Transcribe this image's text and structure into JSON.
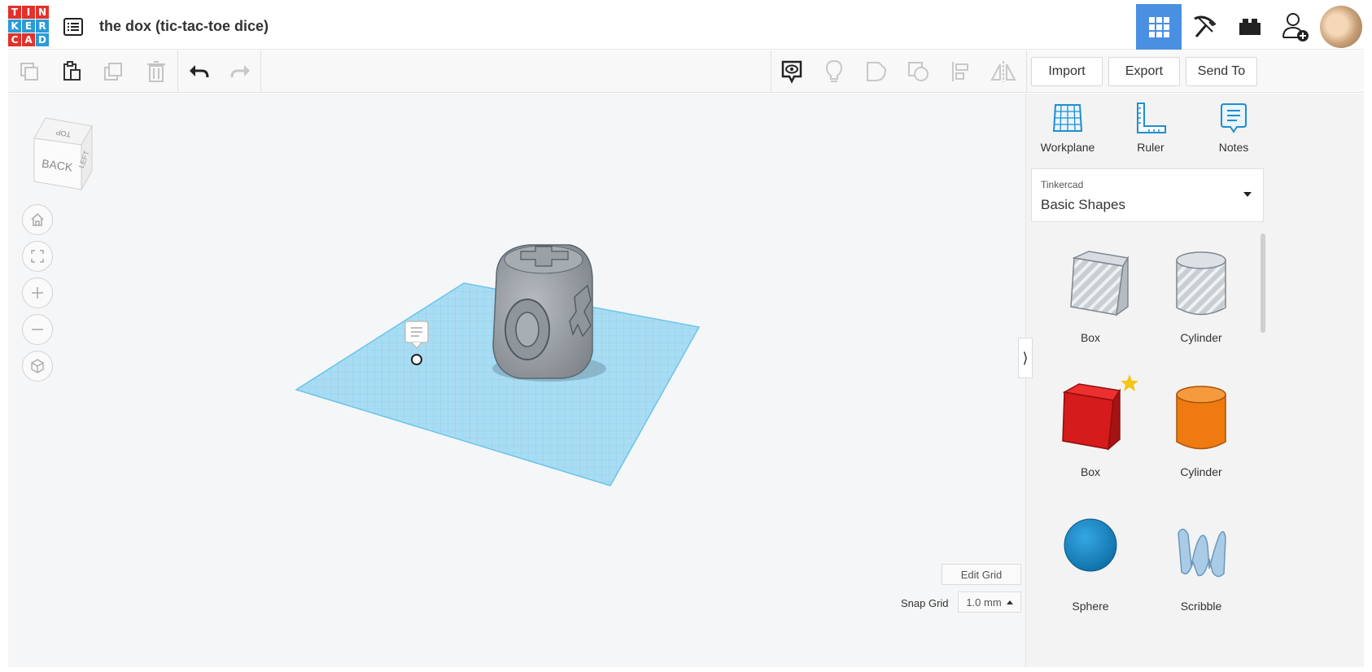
{
  "header": {
    "logo_letters": [
      "T",
      "I",
      "N",
      "K",
      "E",
      "R",
      "C",
      "A",
      "D"
    ],
    "logo_colors": [
      "#e2312b",
      "#e2312b",
      "#e2312b",
      "#2a9bd7",
      "#2a9bd7",
      "#2a9bd7",
      "#e2312b",
      "#e2312b",
      "#2a9bd7"
    ],
    "title": "the dox (tic-tac-toe dice)",
    "right_buttons": [
      "3d-design-grid-icon",
      "pickaxe-icon",
      "bricks-icon",
      "add-user-icon",
      "avatar"
    ]
  },
  "toolbar": {
    "edit_icons": [
      "copy-icon",
      "paste-icon",
      "duplicate-icon",
      "delete-icon",
      "undo-icon",
      "redo-icon"
    ],
    "view_icons": [
      "notes-visibility-icon",
      "lightbulb-icon",
      "group-icon",
      "ungroup-icon",
      "align-icon",
      "mirror-icon"
    ],
    "import_label": "Import",
    "export_label": "Export",
    "send_label": "Send To"
  },
  "canvas": {
    "viewcube_front": "BACK",
    "viewcube_top": "TOP",
    "viewcube_side": "LEFT",
    "nav_icons": [
      "home-icon",
      "fit-icon",
      "zoom-in-icon",
      "zoom-out-icon",
      "perspective-icon"
    ],
    "edit_grid_label": "Edit Grid",
    "snap_grid_label": "Snap Grid",
    "snap_grid_value": "1.0 mm"
  },
  "panel": {
    "tools": [
      {
        "label": "Workplane",
        "icon": "workplane-icon"
      },
      {
        "label": "Ruler",
        "icon": "ruler-icon"
      },
      {
        "label": "Notes",
        "icon": "notes-icon"
      }
    ],
    "library_source": "Tinkercad",
    "library_name": "Basic Shapes",
    "shapes": [
      {
        "label": "Box",
        "kind": "hole-box"
      },
      {
        "label": "Cylinder",
        "kind": "hole-cylinder"
      },
      {
        "label": "Box",
        "kind": "solid-box"
      },
      {
        "label": "Cylinder",
        "kind": "solid-cylinder"
      },
      {
        "label": "Sphere",
        "kind": "sphere"
      },
      {
        "label": "Scribble",
        "kind": "scribble"
      }
    ],
    "colors": {
      "accent": "#4a90e2",
      "box": "#d51b1b",
      "cylinder": "#ee7a10",
      "sphere": "#1f8ed2",
      "scribble": "#a9cbe6"
    }
  }
}
